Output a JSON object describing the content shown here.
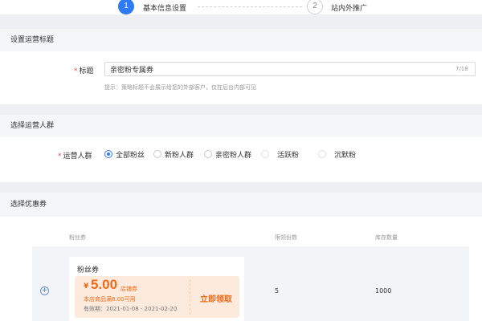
{
  "steps": [
    {
      "number": "1",
      "label": "基本信息设置"
    },
    {
      "number": "2",
      "label": "站内外推广"
    }
  ],
  "sections": {
    "title_section": "设置运营标题",
    "audience_section": "选择运营人群",
    "coupon_section": "选择优惠券"
  },
  "title_field": {
    "required_mark": "*",
    "label": "标题",
    "value": "亲密粉专属券",
    "counter": "7/18",
    "hint": "提示：策略标题不会展示给您的外部客户，仅在后台内部可见"
  },
  "audience_field": {
    "required_mark": "*",
    "label": "运营人群",
    "options": [
      "全部粉丝",
      "新粉人群",
      "亲密粉人群",
      "活跃粉",
      "沉默粉"
    ],
    "selected": "全部粉丝"
  },
  "coupon_table": {
    "headers": [
      "粉丝券",
      "限领份数",
      "库存数量"
    ],
    "row": {
      "expand_symbol": "+",
      "coupon_name": "粉丝券",
      "currency": "¥",
      "amount": "5.00",
      "type_tag": "店铺券",
      "condition": "本店商品满8.00可用",
      "validity": "有效期：2021-01-08 - 2021-02-20",
      "claim_label": "立即领取",
      "limit": "5",
      "stock": "1000"
    }
  },
  "colors": {
    "accent": "#2f7bf5",
    "coupon_orange": "#ee6a1b",
    "coupon_bg": "#fcebdc",
    "required": "#e34d4d"
  }
}
